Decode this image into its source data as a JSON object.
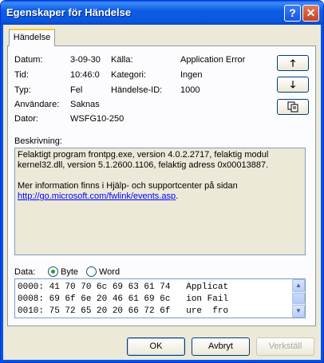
{
  "window": {
    "title": "Egenskaper för Händelse"
  },
  "tabs": [
    {
      "label": "Händelse"
    }
  ],
  "fields": {
    "datum_label": "Datum:",
    "datum_value": "3-09-30",
    "tid_label": "Tid:",
    "tid_value": "10:46:0",
    "typ_label": "Typ:",
    "typ_value": "Fel",
    "anvandare_label": "Användare:",
    "anvandare_value": "Saknas",
    "dator_label": "Dator:",
    "dator_value": "WSFG10-250",
    "kalla_label": "Källa:",
    "kalla_value": "Application Error",
    "kategori_label": "Kategori:",
    "kategori_value": "Ingen",
    "handelse_id_label": "Händelse-ID:",
    "handelse_id_value": "1000"
  },
  "side_buttons": {
    "up_icon": "arrow-up-icon",
    "down_icon": "arrow-down-icon",
    "copy_icon": "copy-icon"
  },
  "description": {
    "label": "Beskrivning:",
    "line1": "Felaktigt program frontpg.exe, version 4.0.2.2717, felaktig modul",
    "line2": "kernel32.dll, version 5.1.2600.1106, felaktig adress 0x00013887.",
    "line3": "Mer information finns i Hjälp- och supportcenter på sidan",
    "link": "http://go.microsoft.com/fwlink/events.asp",
    "link_suffix": "."
  },
  "data_section": {
    "label": "Data:",
    "option_byte": "Byte",
    "option_word": "Word",
    "selected": "Byte",
    "rows": [
      "0000: 41 70 70 6c 69 63 61 74   Applicat",
      "0008: 69 6f 6e 20 46 61 69 6c   ion Fail",
      "0010: 75 72 65 20 20 66 72 6f   ure  fro"
    ]
  },
  "buttons": {
    "ok": "OK",
    "cancel": "Avbryt",
    "apply": "Verkställ"
  },
  "colors": {
    "titlebar": "#0a58e8",
    "dialog_bg": "#ece9d8",
    "radio_selected": "#21a121",
    "link": "#0000ff"
  }
}
